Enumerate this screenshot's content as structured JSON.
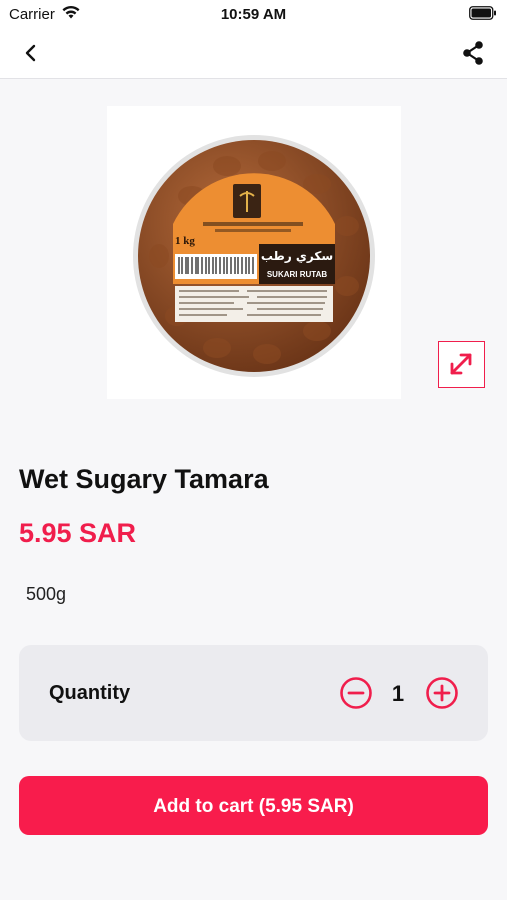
{
  "status_bar": {
    "carrier": "Carrier",
    "time": "10:59 AM",
    "wifi_icon": "wifi-icon",
    "battery_icon": "battery-icon"
  },
  "nav": {
    "back_icon": "chevron-left-icon",
    "share_icon": "share-icon"
  },
  "product": {
    "name": "Wet Sugary Tamara",
    "price": "5.95 SAR",
    "size": "500g",
    "image_label": {
      "weight": "1 kg",
      "arabic_name": "سكري رطب",
      "english_name": "SUKARI RUTAB"
    }
  },
  "quantity": {
    "label": "Quantity",
    "value": "1",
    "minus_icon": "minus-circle-icon",
    "plus_icon": "plus-circle-icon"
  },
  "cart": {
    "button_label": "Add to cart (5.95 SAR)"
  },
  "colors": {
    "accent": "#f01e4c",
    "button": "#f81c4c",
    "background": "#f7f7f9",
    "card": "#ebebef"
  }
}
